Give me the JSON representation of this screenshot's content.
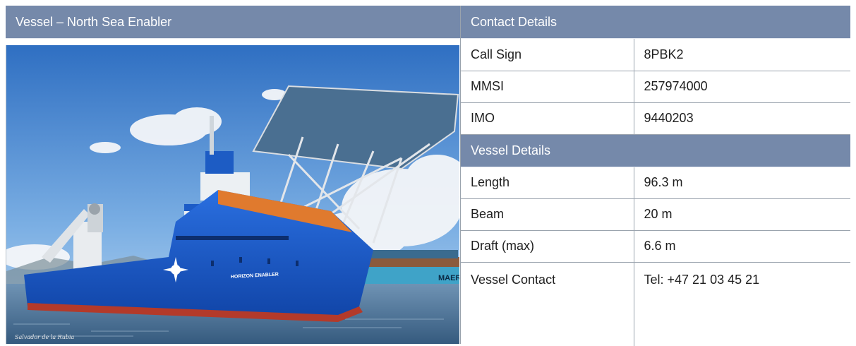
{
  "vessel": {
    "header": "Vessel – North Sea Enabler",
    "photo_hull_name": "HORIZON ENABLER",
    "photo_container_text": "MAER",
    "photo_credit": "Salvador de la Rubia"
  },
  "contact": {
    "header": "Contact Details",
    "rows": [
      {
        "label": "Call Sign",
        "value": "8PBK2"
      },
      {
        "label": "MMSI",
        "value": "257974000"
      },
      {
        "label": "IMO",
        "value": "9440203"
      }
    ]
  },
  "details": {
    "header": "Vessel Details",
    "rows": [
      {
        "label": "Length",
        "value": "96.3 m"
      },
      {
        "label": "Beam",
        "value": "20 m"
      },
      {
        "label": "Draft (max)",
        "value": "6.6 m"
      },
      {
        "label": "Vessel Contact",
        "value": "Tel: +47 21 03 45 21"
      }
    ]
  }
}
